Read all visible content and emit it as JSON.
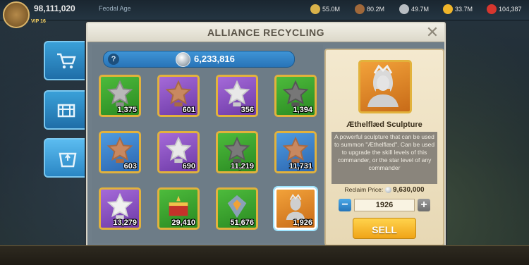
{
  "hud": {
    "power": "98,111,020",
    "name": "Feodal Age",
    "vip": "VIP 16",
    "resources": [
      {
        "icon": "food-icon",
        "value": "55.0M",
        "color": "#d9b24a"
      },
      {
        "icon": "wood-icon",
        "value": "80.2M",
        "color": "#a0683a"
      },
      {
        "icon": "stone-icon",
        "value": "49.7M",
        "color": "#b9bec3"
      },
      {
        "icon": "gold-icon",
        "value": "33.7M",
        "color": "#f0b52a"
      },
      {
        "icon": "gems-icon",
        "value": "104,387",
        "color": "#d6362e"
      }
    ]
  },
  "dialog": {
    "title": "ALLIANCE RECYCLING",
    "silver": "6,233,816",
    "items": [
      {
        "name": "silver-sculpture",
        "bg": "green",
        "qty": "1,375",
        "art": "#8c8c8c",
        "star": "#b8b8b8"
      },
      {
        "name": "bronze-sculpture",
        "bg": "purple",
        "qty": "601",
        "art": "#a86a44",
        "star": "#c88860"
      },
      {
        "name": "silver-star-sculpture",
        "bg": "purple",
        "qty": "356",
        "art": "#c9c9c9",
        "star": "#e8e8e8"
      },
      {
        "name": "black-sculpture",
        "bg": "green",
        "qty": "1,394",
        "art": "#555",
        "star": "#777"
      },
      {
        "name": "bronze-star",
        "bg": "blue",
        "qty": "603",
        "art": "#a86a44",
        "star": "#c88860"
      },
      {
        "name": "silver-star",
        "bg": "purple",
        "qty": "690",
        "art": "#c9c9c9",
        "star": "#e8e8e8"
      },
      {
        "name": "black-star",
        "bg": "green",
        "qty": "11,219",
        "art": "#5a5a5a",
        "star": "#7a7a7a"
      },
      {
        "name": "bronze-star-2",
        "bg": "blue",
        "qty": "11,731",
        "art": "#a86a44",
        "star": "#c88860"
      },
      {
        "name": "silver-star-2",
        "bg": "purple",
        "qty": "13,279",
        "art": "#d6d6d6",
        "star": "#f0f0f0"
      },
      {
        "name": "chest-item",
        "bg": "green",
        "qty": "29,410",
        "art": "#c4322a",
        "star": "#f1c24a"
      },
      {
        "name": "crystal-item",
        "bg": "green",
        "qty": "51,676",
        "art": "#8aa0b8",
        "star": "#f0a236"
      },
      {
        "name": "aethelflaed-sculpture",
        "bg": "orange",
        "qty": "1,926",
        "art": "#cfcfcf",
        "star": "#e8e8e8"
      }
    ],
    "detail": {
      "name": "Æthelflæd Sculpture",
      "description": "A powerful sculpture that can be used to summon \"Æthelflæd\". Can be used to upgrade the skill levels of this commander, or the star level of any commander",
      "reclaim_label": "Reclaim Price:",
      "reclaim_price": "9,630,000",
      "quantity": "1926",
      "sell_label": "SELL"
    }
  }
}
